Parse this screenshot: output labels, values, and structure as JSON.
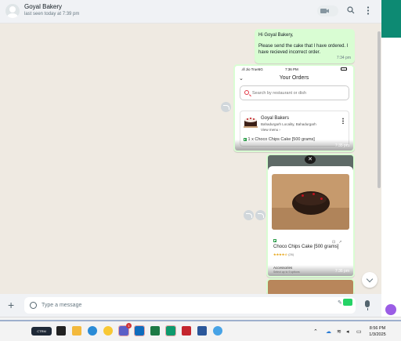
{
  "header": {
    "contact_name": "Goyal Bakery",
    "last_seen": "last seen today at 7:39 pm"
  },
  "messages": {
    "text_message": {
      "greeting": "Hi Goyal Bakery,",
      "body": "Please send the cake that I have ordered. I have recieved incorrect order.",
      "time": "7:34 pm"
    },
    "screenshot_1": {
      "status_left": ".ıll Jio True5G",
      "status_time": "7:36 PM",
      "title": "Your Orders",
      "search_placeholder": "Search by restaurant or dish",
      "restaurant_name": "Goyal Bakers",
      "location": "Bahadurgarh Locality, Bahadurgarh",
      "view_menu": "View menu ›",
      "order_item": "1 x Choco Chips Cake [500 grams]",
      "time": "7:35 pm"
    },
    "screenshot_2": {
      "close_glyph": "✕",
      "product_title": "Choco Chips Cake [500 grams]",
      "rating_stars": "★★★★☆",
      "rating_count": "(26)",
      "section": "Accessories",
      "section_sub": "Select up to 9 options",
      "time": "7:36 pm"
    }
  },
  "composer": {
    "placeholder": "Type a message"
  },
  "taskbar": {
    "weather": "CTRM",
    "teams_badge": "1",
    "time": "8:56 PM",
    "date": "1/3/2025"
  },
  "colors": {
    "outgoing_bubble": "#d9fdd3",
    "chat_bg": "#efeae2",
    "accent": "#0d8a73"
  }
}
